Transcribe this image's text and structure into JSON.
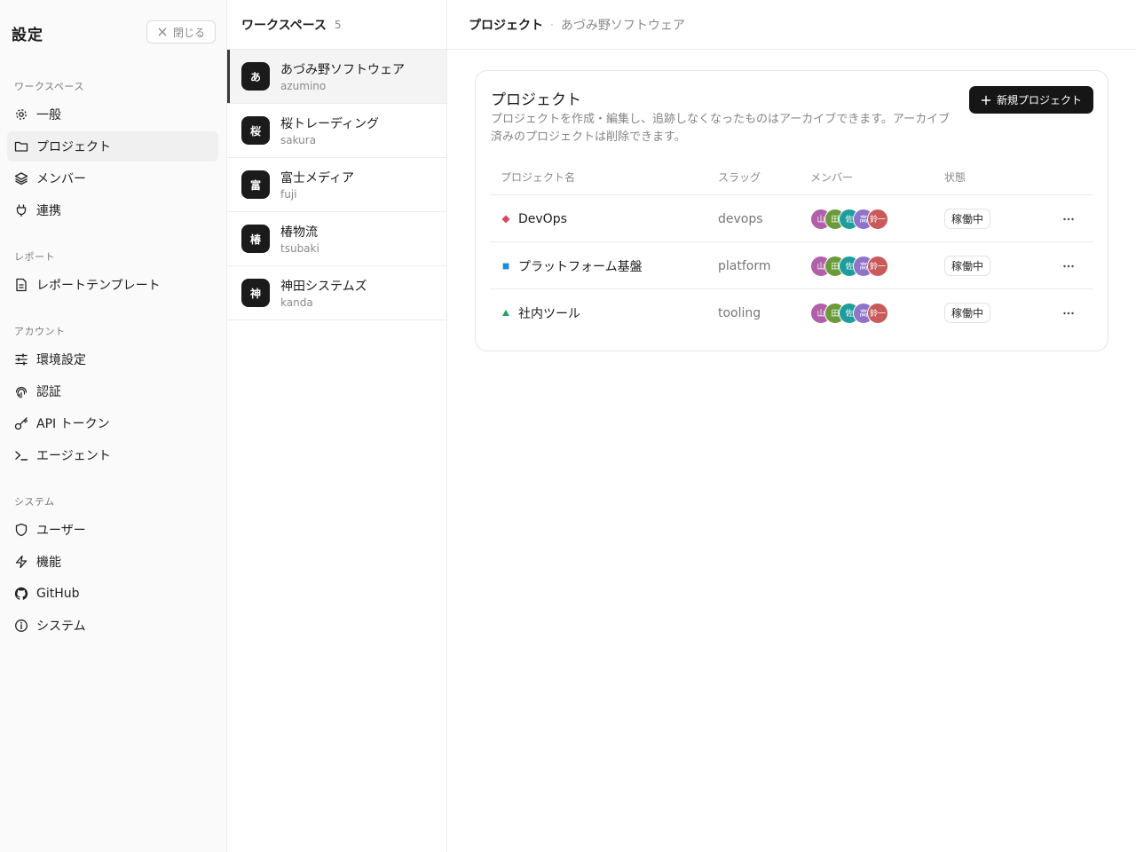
{
  "settings": {
    "title": "設定",
    "close_label": "閉じる",
    "sections": [
      {
        "label": "ワークスペース",
        "items": [
          {
            "label": "一般",
            "icon": "gear-icon"
          },
          {
            "label": "プロジェクト",
            "icon": "folder-icon",
            "active": true
          },
          {
            "label": "メンバー",
            "icon": "layers-icon"
          },
          {
            "label": "連携",
            "icon": "plug-icon"
          }
        ]
      },
      {
        "label": "レポート",
        "items": [
          {
            "label": "レポートテンプレート",
            "icon": "document-icon"
          }
        ]
      },
      {
        "label": "アカウント",
        "items": [
          {
            "label": "環境設定",
            "icon": "sliders-icon"
          },
          {
            "label": "認証",
            "icon": "fingerprint-icon"
          },
          {
            "label": "API トークン",
            "icon": "key-icon"
          },
          {
            "label": "エージェント",
            "icon": "terminal-icon"
          }
        ]
      },
      {
        "label": "システム",
        "items": [
          {
            "label": "ユーザー",
            "icon": "shield-icon"
          },
          {
            "label": "機能",
            "icon": "zap-icon"
          },
          {
            "label": "GitHub",
            "icon": "github-icon"
          },
          {
            "label": "システム",
            "icon": "info-icon"
          }
        ]
      }
    ]
  },
  "workspaces": {
    "title": "ワークスペース",
    "count": "5",
    "items": [
      {
        "badge": "あ",
        "name": "あづみ野ソフトウェア",
        "slug": "azumino",
        "active": true
      },
      {
        "badge": "桜",
        "name": "桜トレーディング",
        "slug": "sakura"
      },
      {
        "badge": "富",
        "name": "富士メディア",
        "slug": "fuji"
      },
      {
        "badge": "椿",
        "name": "椿物流",
        "slug": "tsubaki"
      },
      {
        "badge": "神",
        "name": "神田システムズ",
        "slug": "kanda"
      }
    ]
  },
  "main": {
    "breadcrumb": {
      "current": "プロジェクト",
      "separator": "·",
      "workspace": "あづみ野ソフトウェア"
    },
    "card": {
      "title": "プロジェクト",
      "description": "プロジェクトを作成・編集し、追跡しなくなったものはアーカイブできます。アーカイブ済みのプロジェクトは削除できます。",
      "new_button": "新規プロジェクト"
    },
    "table": {
      "headers": {
        "name": "プロジェクト名",
        "slug": "スラッグ",
        "members": "メンバー",
        "status": "状態"
      },
      "rows": [
        {
          "icon": "diamond",
          "icon_color": "#d04b5e",
          "name": "DevOps",
          "slug": "devops",
          "status": "稼働中"
        },
        {
          "icon": "square",
          "icon_color": "#1e8ad0",
          "name": "プラットフォーム基盤",
          "slug": "platform",
          "status": "稼働中"
        },
        {
          "icon": "triangle",
          "icon_color": "#2a9d5c",
          "name": "社内ツール",
          "slug": "tooling",
          "status": "稼働中"
        }
      ],
      "members": [
        {
          "initials": "山",
          "color": "#b05fa8"
        },
        {
          "initials": "田",
          "color": "#6a9a3a"
        },
        {
          "initials": "佐",
          "color": "#1f9c9c"
        },
        {
          "initials": "高",
          "color": "#8f73c9"
        },
        {
          "initials": "鈴一",
          "color": "#c95a5a"
        }
      ]
    }
  }
}
